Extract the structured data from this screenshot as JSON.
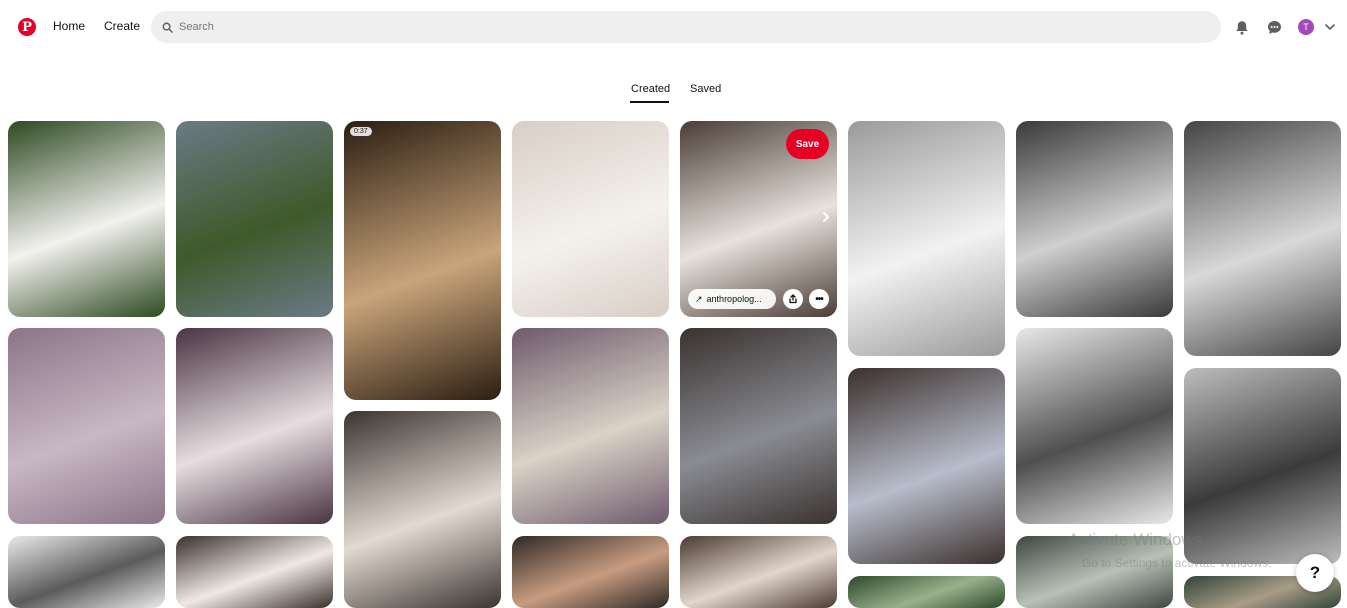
{
  "header": {
    "logo_letter": "P",
    "nav": {
      "home": "Home",
      "create": "Create"
    },
    "search": {
      "placeholder": "Search"
    },
    "avatar_initial": "T",
    "icons": [
      "pinterest-logo",
      "search-icon",
      "bell-icon",
      "chat-icon",
      "chevron-down-icon"
    ]
  },
  "tabs": {
    "created": "Created",
    "saved": "Saved",
    "active": "Created"
  },
  "pins": [
    {
      "label": "wedding-couple-grass",
      "colors": [
        "#2e4a22",
        "#f2f1ee"
      ]
    },
    {
      "label": "wedding-couple-field",
      "colors": [
        "#6b7a86",
        "#3f5a2a"
      ]
    },
    {
      "label": "video-glass-pour",
      "colors": [
        "#2b1e12",
        "#c9a47a"
      ],
      "duration": "0:37"
    },
    {
      "label": "white-bow-gown",
      "colors": [
        "#d8cec6",
        "#f4f1ec"
      ]
    },
    {
      "label": "strapless-corset-dress",
      "colors": [
        "#4a3d36",
        "#e8e2dc"
      ],
      "save": "Save",
      "source": "anthropolog..."
    },
    {
      "label": "bw-couple-pier",
      "colors": [
        "#9a9a9a",
        "#f2f2f2"
      ]
    },
    {
      "label": "bw-bride-beach",
      "colors": [
        "#3a3a3a",
        "#cfcfcf"
      ]
    },
    {
      "label": "bw-couple-walk",
      "colors": [
        "#454545",
        "#d8d8d8"
      ]
    },
    {
      "label": "lilac-wall-mirror",
      "colors": [
        "#8a7588",
        "#c8b7c4"
      ]
    },
    {
      "label": "lilac-towel-sink",
      "colors": [
        "#4a3442",
        "#e6dde0"
      ]
    },
    {
      "label": "lilac-bathroom-vanity",
      "colors": [
        "#6e5a6c",
        "#d9d2c6"
      ]
    },
    {
      "label": "denim-jacket-hat",
      "colors": [
        "#3a322f",
        "#8a8c93"
      ]
    },
    {
      "label": "patchwork-blouse",
      "colors": [
        "#3b302c",
        "#b7bccb"
      ]
    },
    {
      "label": "bw-knit-sweater",
      "colors": [
        "#e8e8e8",
        "#4f4f4f"
      ]
    },
    {
      "label": "bw-woman-hat",
      "colors": [
        "#bdbdbd",
        "#3b3b3b"
      ]
    },
    {
      "label": "boho-boots-outfit",
      "colors": [
        "#3b3430",
        "#e2d9d0"
      ]
    },
    {
      "label": "white-embroidered-top",
      "colors": [
        "#eaeaea",
        "#5b5b5b"
      ]
    },
    {
      "label": "white-blouse-curly",
      "colors": [
        "#3b302b",
        "#efe9e4"
      ]
    },
    {
      "label": "curly-hair-portrait",
      "colors": [
        "#2f2926",
        "#c79c80"
      ]
    },
    {
      "label": "cowboy-hat-lace",
      "colors": [
        "#4a3a33",
        "#e2d6cc"
      ]
    },
    {
      "label": "trees-outdoor",
      "colors": [
        "#2d4a2c",
        "#9ab08b"
      ]
    },
    {
      "label": "umbrella-group",
      "colors": [
        "#3f4640",
        "#b8c1b8"
      ]
    },
    {
      "label": "green-people-scene",
      "colors": [
        "#31443a",
        "#a89c86"
      ]
    }
  ],
  "overlay": {
    "activate_title": "Activate Windows",
    "activate_sub": "Go to Settings to activate Windows.",
    "help": "?"
  }
}
